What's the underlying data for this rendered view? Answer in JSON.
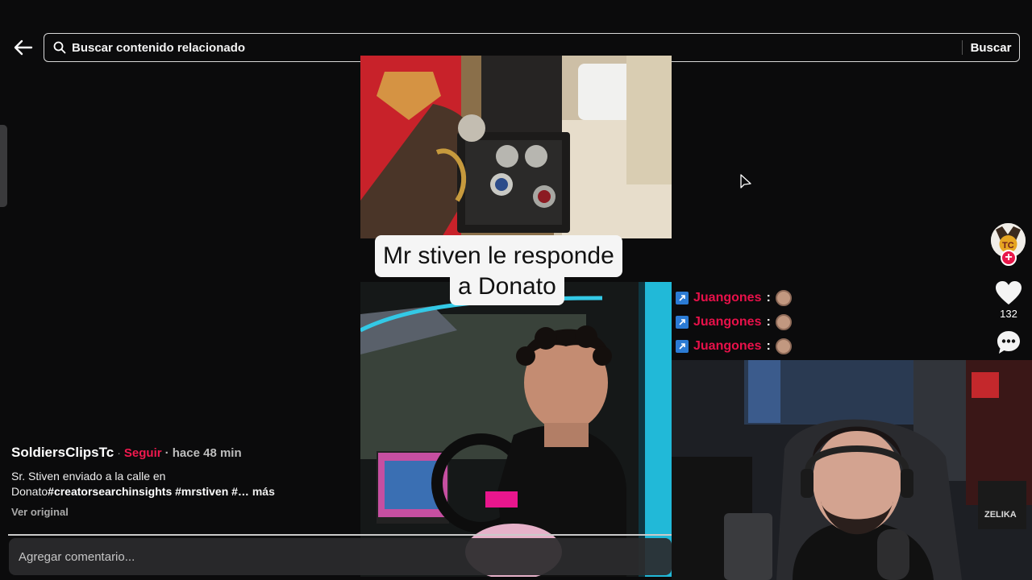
{
  "search": {
    "placeholder": "Buscar contenido relacionado",
    "button_label": "Buscar"
  },
  "video": {
    "caption_line1": "Mr stiven le responde",
    "caption_line2": "a Donato"
  },
  "chat": {
    "messages": [
      {
        "user": "Juangones",
        "separator": ":"
      },
      {
        "user": "Juangones",
        "separator": ":"
      },
      {
        "user": "Juangones",
        "separator": ":"
      }
    ]
  },
  "actions": {
    "like_count": "132",
    "follow_plus": "+"
  },
  "post": {
    "author": "SoldiersClipsTc",
    "separator": "·",
    "follow_label": "Seguir",
    "time": "· hace 48 min",
    "description_text": "Sr. Stiven enviado a la calle en Donato",
    "hashtags": "#creatorsearchinsights #mrstiven #…",
    "more_label": "más",
    "original_label": "Ver original"
  },
  "comment": {
    "placeholder": "Agregar comentario..."
  },
  "overlay": {
    "webcam_sign": "ZELIKA"
  },
  "colors": {
    "accent": "#f0194e",
    "chat_user": "#e8114a",
    "badge": "#2b7bd4"
  },
  "icons": [
    "back-arrow-icon",
    "search-icon",
    "heart-icon",
    "comment-bubble-icon",
    "cursor-icon",
    "plus-icon"
  ]
}
